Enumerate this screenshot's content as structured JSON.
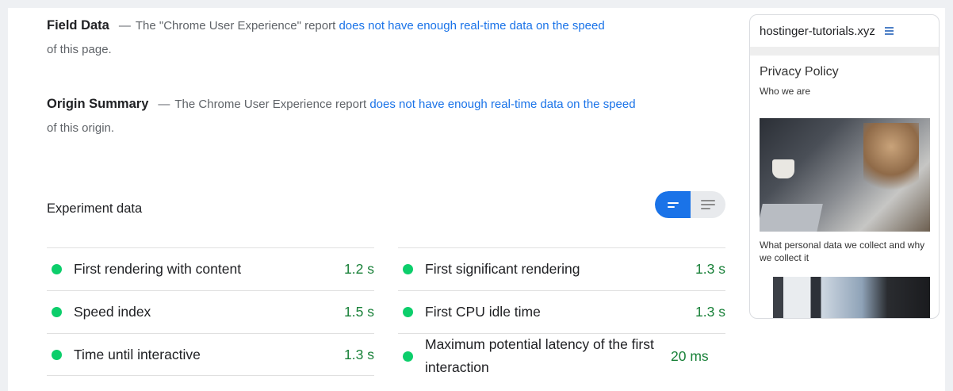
{
  "field_data": {
    "heading": "Field Data",
    "dash": "—",
    "text_before": "The \"Chrome User Experience\" report",
    "link": "does not have enough real-time data on the speed",
    "text_after": "of this page."
  },
  "origin_summary": {
    "heading": "Origin Summary",
    "dash": "—",
    "text_before": "The Chrome User Experience report",
    "link": "does not have enough real-time data on the speed",
    "text_after": "of this origin."
  },
  "experiment": {
    "title": "Experiment data",
    "view_toggle": {
      "selected": "summary",
      "options": [
        "summary-view-icon",
        "list-view-icon"
      ],
      "accent": "#1a73e8"
    }
  },
  "metrics_left": [
    {
      "label": "First rendering with content",
      "value": "1.2 s",
      "status": "good"
    },
    {
      "label": "Speed index",
      "value": "1.5 s",
      "status": "good"
    },
    {
      "label": "Time until interactive",
      "value": "1.3 s",
      "status": "good"
    }
  ],
  "metrics_right": [
    {
      "label": "First significant rendering",
      "value": "1.3 s",
      "status": "good"
    },
    {
      "label": "First CPU idle time",
      "value": "1.3 s",
      "status": "good"
    },
    {
      "label": "Maximum potential latency of the first interaction",
      "value": "20 ms",
      "status": "good"
    }
  ],
  "status_colors": {
    "good": "#0cce6b",
    "value_text": "#188038"
  },
  "preview": {
    "site": "hostinger-tutorials.xyz",
    "menu_icon": "hamburger-menu-icon",
    "page_title": "Privacy Policy",
    "subheading": "Who we are",
    "paragraph": "What personal data we collect and why we collect it"
  }
}
